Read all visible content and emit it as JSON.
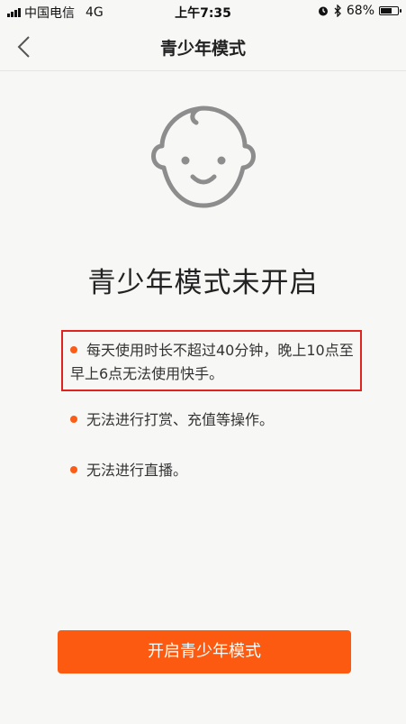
{
  "status_bar": {
    "carrier": "中国电信",
    "network": "4G",
    "time": "上午7:35",
    "battery_text": "68%",
    "battery_level": 0.68
  },
  "nav": {
    "title": "青少年模式",
    "back_icon": "chevron-left-icon"
  },
  "illustration": {
    "icon": "baby-face-icon"
  },
  "headline": "青少年模式未开启",
  "rules": [
    {
      "text": "每天使用时长不超过40分钟，晚上10点至早上6点无法使用快手。",
      "highlighted": true
    },
    {
      "text": "无法进行打赏、充值等操作。",
      "highlighted": false
    },
    {
      "text": "无法进行直播。",
      "highlighted": false
    }
  ],
  "action": {
    "label": "开启青少年模式"
  },
  "colors": {
    "accent": "#fb5a10",
    "bullet": "#fb5d16",
    "highlight_border": "#e0231f",
    "background": "#f7f7f5"
  }
}
